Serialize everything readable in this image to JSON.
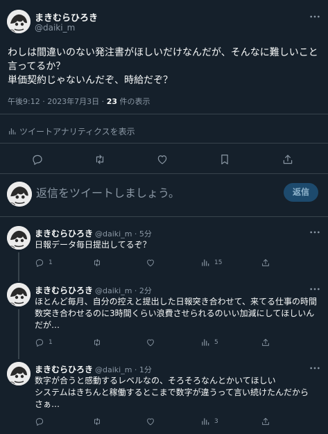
{
  "main_tweet": {
    "display_name": "まきむらひろき",
    "handle": "@daiki_m",
    "body": "わしは間違いのない発注書がほしいだけなんだが、そんなに難しいこと\n言ってるか？\n単価契約じゃないんだぞ、時給だぞ？",
    "timestamp": "午後9:12 · 2023年7月3日 · ",
    "views_count": "23",
    "views_label": " 件の表示",
    "analytics_label": "ツイートアナリティクスを表示"
  },
  "composer": {
    "placeholder": "返信をツイートしましょう。",
    "button_label": "返信"
  },
  "replies": [
    {
      "display_name": "まきむらひろき",
      "handle": "@daiki_m · 5分",
      "body": "日報データ毎日提出してるぞ？",
      "reply_count": "1",
      "retweet_count": "",
      "like_count": "",
      "views_count": "15"
    },
    {
      "display_name": "まきむらひろき",
      "handle": "@daiki_m · 2分",
      "body": "ほとんど毎月、自分の控えと提出した日報突き合わせて、来てる仕事の時間\n数突き合わせるのに3時間くらい浪費させられるのいい加減にしてほしいん\nだが…",
      "reply_count": "1",
      "retweet_count": "",
      "like_count": "",
      "views_count": "5"
    },
    {
      "display_name": "まきむらひろき",
      "handle": "@daiki_m · 1分",
      "body": "数字が合うと感動するレベルなの、そろそろなんとかいてほしい\nシステムはきちんと稼働するとこまで数字が違うって言い続けたんだから\nさぁ…",
      "reply_count": "",
      "retweet_count": "",
      "like_count": "",
      "views_count": "3"
    }
  ],
  "colors": {
    "background": "#15202b",
    "text": "#f7f9f9",
    "muted": "#8b98a5",
    "divider": "#38444d",
    "reply_button": "#1d4a6d"
  }
}
